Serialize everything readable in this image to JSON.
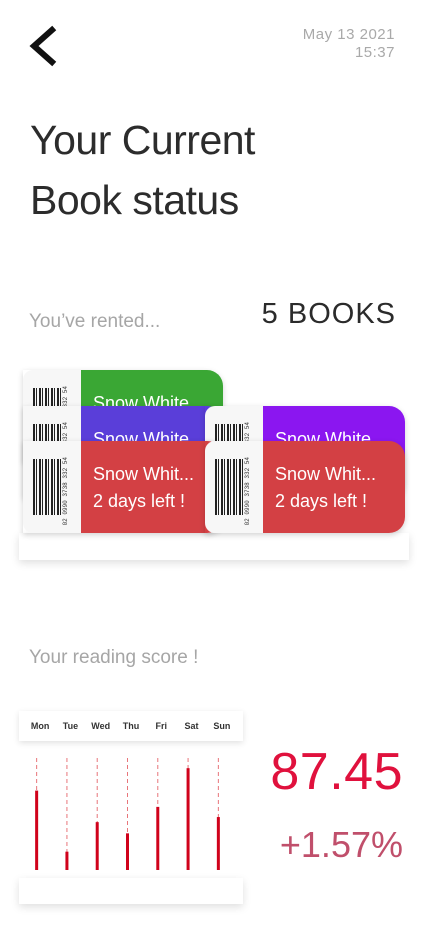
{
  "header": {
    "date": "May 13 2021",
    "time": "15:37"
  },
  "title": {
    "line1": "Your Current",
    "line2": "Book status"
  },
  "rented": {
    "label": "You’ve rented...",
    "count": "5 BOOKS"
  },
  "books": [
    {
      "title": "Snow White",
      "status": "",
      "code": "02 0990 3738 332 54",
      "color": "#3aa734"
    },
    {
      "title": "Snow White",
      "status": "",
      "code": "02 0990 3738 332 54",
      "color": "#5a3ed9"
    },
    {
      "title": "Snow Whit...",
      "status": "2 days left !",
      "code": "02 0990 3738 332 54",
      "color": "#d34044"
    },
    {
      "title": "Snow White",
      "status": "",
      "code": "02 0990 3738 332 54",
      "color": "#8b16f0"
    },
    {
      "title": "Snow Whit...",
      "status": "2 days left !",
      "code": "02 0990 3738 332 54",
      "color": "#d34044"
    }
  ],
  "reading": {
    "label": "Your reading score !",
    "days": [
      "Mon",
      "Tue",
      "Wed",
      "Thu",
      "Fri",
      "Sat",
      "Sun"
    ],
    "score": "87.45",
    "change": "+1.57%"
  },
  "chart_data": {
    "type": "bar",
    "categories": [
      "Mon",
      "Tue",
      "Wed",
      "Thu",
      "Fri",
      "Sat",
      "Sun"
    ],
    "values": [
      78,
      18,
      47,
      36,
      62,
      100,
      52
    ],
    "ylim": [
      0,
      110
    ],
    "bar_color": "#d0021b",
    "guide_color": "#e8757a"
  }
}
